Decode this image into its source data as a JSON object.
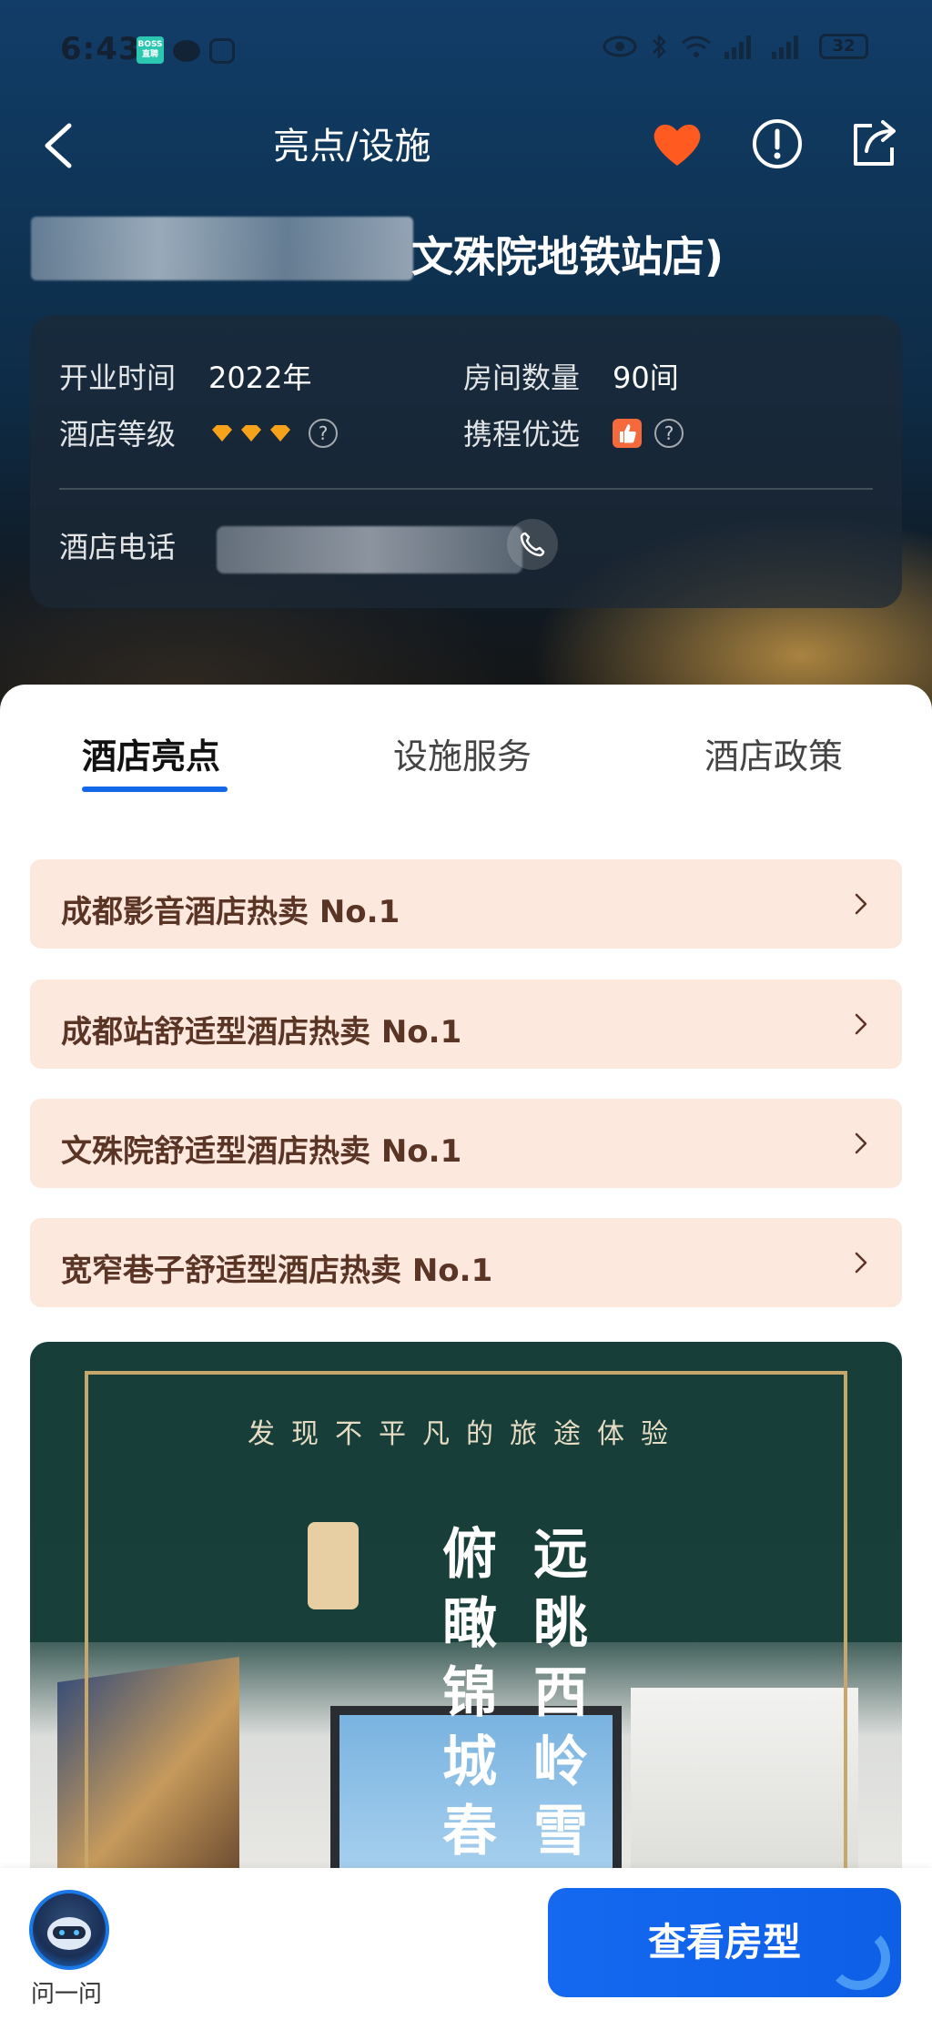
{
  "status_bar": {
    "time": "6:43",
    "boss_badge": "BOSS直聘",
    "battery": "32"
  },
  "nav": {
    "title": "亮点/设施",
    "icons": [
      "back-arrow-icon",
      "heart-icon",
      "info-icon",
      "share-icon"
    ],
    "favorite_color": "#ff5a1f"
  },
  "hotel": {
    "name_visible": "文殊院地铁站店)"
  },
  "info": {
    "open_label": "开业时间",
    "open_value": "2022年",
    "rooms_label": "房间数量",
    "rooms_value": "90间",
    "grade_label": "酒店等级",
    "grade_diamonds": 3,
    "preferred_label": "携程优选",
    "phone_label": "酒店电话",
    "help_glyph": "?"
  },
  "tabs": [
    {
      "label": "酒店亮点",
      "active": true
    },
    {
      "label": "设施服务",
      "active": false
    },
    {
      "label": "酒店政策",
      "active": false
    }
  ],
  "highlights": [
    {
      "text": "成都影音酒店热卖 No.1"
    },
    {
      "text": "成都站舒适型酒店热卖 No.1"
    },
    {
      "text": "文殊院舒适型酒店热卖 No.1"
    },
    {
      "text": "宽窄巷子舒适型酒店热卖 No.1"
    }
  ],
  "promo": {
    "tagline": "发现不平凡的旅途体验",
    "col_right": "远眺西岭雪",
    "col_left": "俯瞰锦城春"
  },
  "bottom": {
    "assistant_label": "问一问",
    "cta_label": "查看房型"
  },
  "colors": {
    "accent": "#1467e8",
    "highlight_bg": "#fde8de",
    "highlight_text": "#5a3424",
    "diamond": "#f7a21b"
  }
}
